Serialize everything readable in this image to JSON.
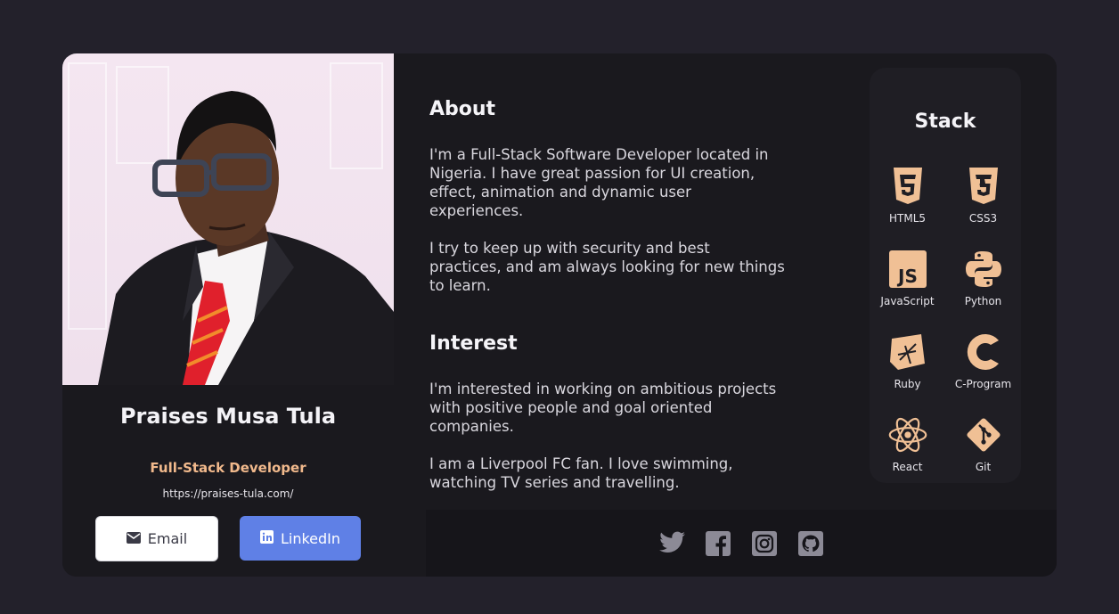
{
  "profile": {
    "name": "Praises Musa Tula",
    "role": "Full-Stack Developer",
    "website": "https://praises-tula.com/",
    "email_label": "Email",
    "linkedin_label": "LinkedIn"
  },
  "about": {
    "heading": "About",
    "paragraph1": "I'm a Full-Stack Software Developer located in Nigeria. I have great passion for UI creation, effect, animation and dynamic user experiences.",
    "paragraph2": "I try to keep up with security and best practices, and am always looking for new things to learn."
  },
  "interest": {
    "heading": "Interest",
    "paragraph1": "I'm interested in working on ambitious projects with positive people and goal oriented companies.",
    "paragraph2": "I am a Liverpool FC fan. I love swimming, watching TV series and travelling."
  },
  "stack": {
    "heading": "Stack",
    "items": [
      {
        "label": "HTML5",
        "icon": "html5-icon"
      },
      {
        "label": "CSS3",
        "icon": "css3-icon"
      },
      {
        "label": "JavaScript",
        "icon": "javascript-icon"
      },
      {
        "label": "Python",
        "icon": "python-icon"
      },
      {
        "label": "Ruby",
        "icon": "ruby-icon"
      },
      {
        "label": "C-Program",
        "icon": "c-icon"
      },
      {
        "label": "React",
        "icon": "react-icon"
      },
      {
        "label": "Git",
        "icon": "git-icon"
      }
    ]
  },
  "social": [
    "twitter-icon",
    "facebook-icon",
    "instagram-icon",
    "github-icon"
  ],
  "colors": {
    "background": "#23212b",
    "card": "#1a191e",
    "accent": "#f1b98c",
    "linkedin": "#5f80e6",
    "icon": "#f0c095",
    "social": "#8c8a96"
  }
}
